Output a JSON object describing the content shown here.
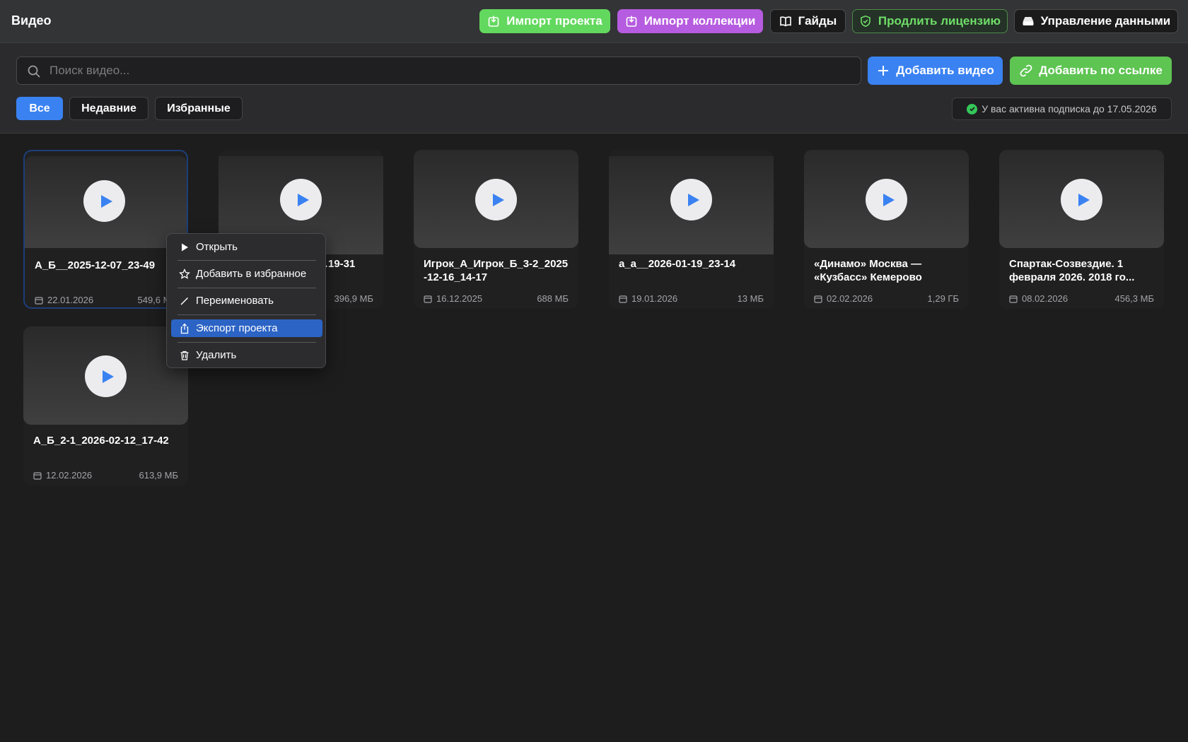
{
  "header": {
    "title": "Видео",
    "buttons": {
      "import_project": "Импорт проекта",
      "import_collection": "Импорт коллекции",
      "guides": "Гайды",
      "extend_license": "Продлить лицензию",
      "data_management": "Управление данными"
    }
  },
  "toolbar": {
    "search_placeholder": "Поиск видео...",
    "add_video": "Добавить видео",
    "add_by_link": "Добавить по ссылке",
    "filters": {
      "all": "Все",
      "recent": "Недавние",
      "favorites": "Избранные"
    },
    "subscription": "У вас активна подписка до 17.05.2026"
  },
  "videos": [
    {
      "title": "А_Б__2025-12-07_23-49",
      "date": "22.01.2026",
      "size": "549,6 МБ"
    },
    {
      "title": "…19-31",
      "date": "",
      "size": "396,9 МБ"
    },
    {
      "title": "Игрок_А_Игрок_Б_3-2_2025-12-16_14-17",
      "date": "16.12.2025",
      "size": "688 МБ"
    },
    {
      "title": "а_а__2026-01-19_23-14",
      "date": "19.01.2026",
      "size": "13 МБ"
    },
    {
      "title": "«Динамо» Москва — «Кузбасс» Кемерово",
      "date": "02.02.2026",
      "size": "1,29 ГБ"
    },
    {
      "title": "Спартак-Созвездие. 1 февраля  2026. 2018 го...",
      "date": "08.02.2026",
      "size": "456,3 МБ"
    },
    {
      "title": "А_Б_2-1_2026-02-12_17-42",
      "date": "12.02.2026",
      "size": "613,9 МБ"
    }
  ],
  "context_menu": {
    "open": "Открыть",
    "add_favorite": "Добавить в избранное",
    "rename": "Переименовать",
    "export_project": "Экспорт проекта",
    "delete": "Удалить"
  },
  "colors": {
    "accent_blue": "#3a82f2",
    "green": "#63d85e",
    "purple": "#b65ce0",
    "menu_highlight": "#2c64c5"
  }
}
